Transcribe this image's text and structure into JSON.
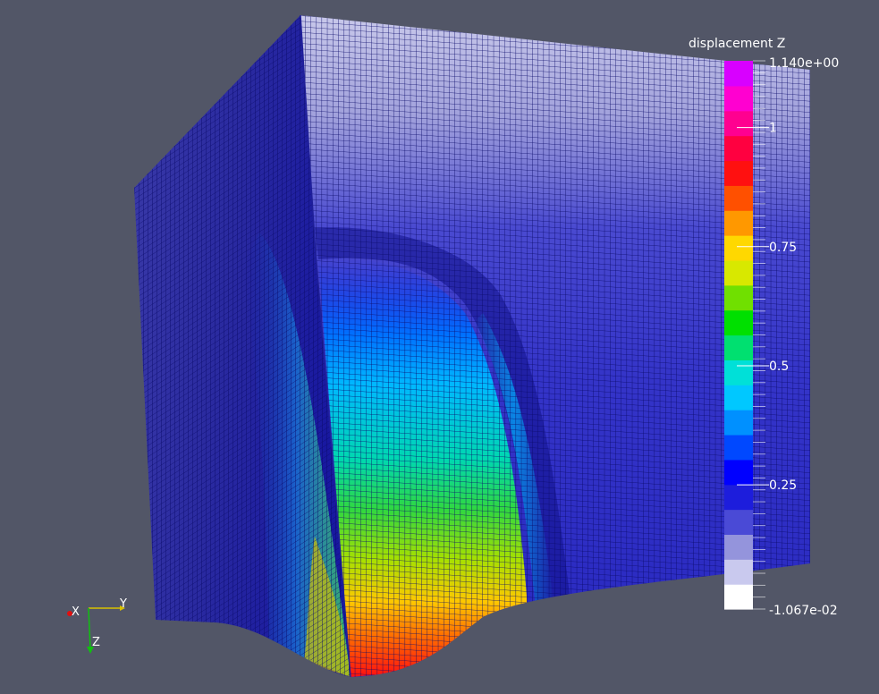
{
  "colorbar": {
    "title": "displacement Z",
    "max_label": "1.140e+00",
    "min_label": "-1.067e-02",
    "ticks": [
      {
        "value": 1.0,
        "label": "1"
      },
      {
        "value": 0.75,
        "label": "0.75"
      },
      {
        "value": 0.5,
        "label": "0.5"
      },
      {
        "value": 0.25,
        "label": "0.25"
      }
    ],
    "range": [
      -0.01067,
      1.14
    ],
    "colors": [
      "#ffffff",
      "#c9c9ee",
      "#9494dc",
      "#4a4ad6",
      "#1d1ddc",
      "#0000ff",
      "#0048ff",
      "#0090ff",
      "#00c8ff",
      "#00e0d8",
      "#00e070",
      "#00e000",
      "#70e000",
      "#d8e800",
      "#ffd800",
      "#ff9800",
      "#ff5000",
      "#ff1010",
      "#ff0040",
      "#ff0090",
      "#ff00d0",
      "#d800ff"
    ]
  },
  "axes": {
    "x_label": "X",
    "y_label": "Y",
    "z_label": "Z",
    "x_color": "#e01010",
    "y_color": "#d8c000",
    "z_color": "#10c010"
  }
}
